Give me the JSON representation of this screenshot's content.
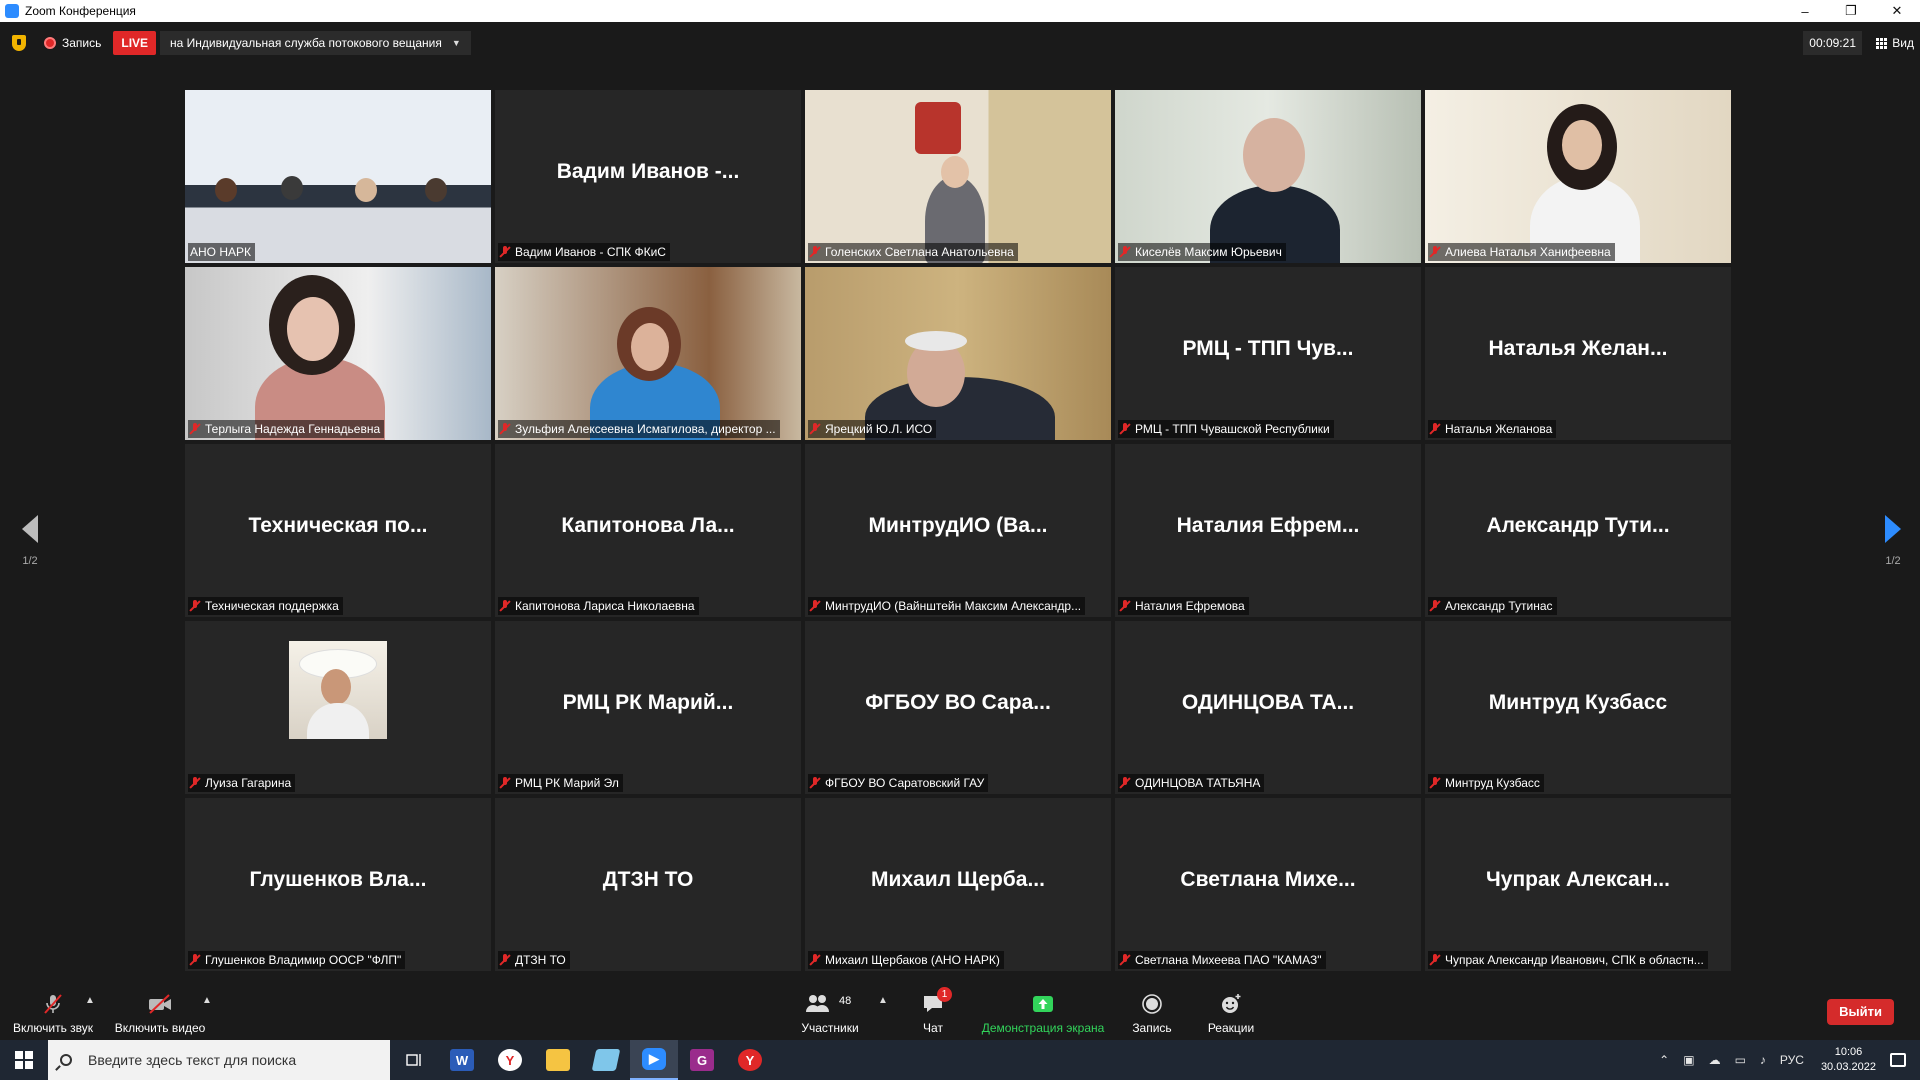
{
  "window": {
    "title": "Zoom Конференция",
    "controls": [
      "–",
      "❐",
      "✕"
    ]
  },
  "topbar": {
    "record_label": "Запись",
    "live_label": "LIVE",
    "stream_target": "на Индивидуальная служба потокового вещания",
    "timer": "00:09:21",
    "view_label": "Вид"
  },
  "tiles": [
    {
      "big": "",
      "label": "АНО НАРК",
      "muted": false,
      "active": true
    },
    {
      "big": "Вадим Иванов -...",
      "label": "Вадим Иванов - СПК ФКиС",
      "muted": true
    },
    {
      "big": "",
      "label": "Голенских Светлана Анатольевна",
      "muted": true
    },
    {
      "big": "",
      "label": "Киселёв Максим Юрьевич",
      "muted": true
    },
    {
      "big": "",
      "label": "Алиева Наталья Ханифеевна",
      "muted": true
    },
    {
      "big": "",
      "label": "Терлыга Надежда Геннадьевна",
      "muted": true
    },
    {
      "big": "",
      "label": "Зульфия Алексеевна Исмагилова, директор ...",
      "muted": true
    },
    {
      "big": "",
      "label": "Ярецкий Ю.Л. ИСО",
      "muted": true
    },
    {
      "big": "РМЦ - ТПП Чув...",
      "label": "РМЦ - ТПП Чувашской Республики",
      "muted": true
    },
    {
      "big": "Наталья Желан...",
      "label": "Наталья Желанова",
      "muted": true
    },
    {
      "big": "Техническая по...",
      "label": "Техническая поддержка",
      "muted": true
    },
    {
      "big": "Капитонова Ла...",
      "label": "Капитонова Лариса Николаевна",
      "muted": true
    },
    {
      "big": "МинтрудИО (Ва...",
      "label": "МинтрудИО (Вайнштейн Максим Александр...",
      "muted": true
    },
    {
      "big": "Наталия Ефрем...",
      "label": "Наталия Ефремова",
      "muted": true
    },
    {
      "big": "Александр Тути...",
      "label": "Александр Тутинас",
      "muted": true
    },
    {
      "big": "",
      "label": "Луиза Гагарина",
      "muted": true
    },
    {
      "big": "РМЦ РК Марий...",
      "label": "РМЦ РК Марий Эл",
      "muted": true
    },
    {
      "big": "ФГБОУ ВО Сара...",
      "label": "ФГБОУ ВО Саратовский ГАУ",
      "muted": true
    },
    {
      "big": "ОДИНЦОВА ТА...",
      "label": "ОДИНЦОВА ТАТЬЯНА",
      "muted": true
    },
    {
      "big": "Минтруд Кузбасс",
      "label": "Минтруд Кузбасс",
      "muted": true
    },
    {
      "big": "Глушенков Вла...",
      "label": "Глушенков Владимир ООСР \"ФЛП\"",
      "muted": true
    },
    {
      "big": "ДТЗН ТО",
      "label": "ДТЗН ТО",
      "muted": true
    },
    {
      "big": "Михаил Щерба...",
      "label": "Михаил Щербаков (АНО НАРК)",
      "muted": true
    },
    {
      "big": "Светлана Михе...",
      "label": "Светлана Михеева ПАО \"КАМАЗ\"",
      "muted": true
    },
    {
      "big": "Чупрак Алексан...",
      "label": "Чупрак Александр Иванович, СПК в областн...",
      "muted": true
    }
  ],
  "pager": {
    "left": "1/2",
    "right": "1/2"
  },
  "toolbar": {
    "unmute": "Включить звук",
    "start_video": "Включить видео",
    "participants": "Участники",
    "participants_count": "48",
    "chat": "Чат",
    "chat_badge": "1",
    "share": "Демонстрация экрана",
    "record": "Запись",
    "reactions": "Реакции",
    "leave": "Выйти"
  },
  "taskbar": {
    "search_placeholder": "Введите здесь текст для поиска",
    "lang": "РУС",
    "time": "10:06",
    "date": "30.03.2022"
  },
  "colors": {
    "accent": "#2d8cff",
    "live": "#e02828",
    "active_speaker": "#c4dc36",
    "share_green": "#32d45b",
    "leave": "#d52b2b"
  }
}
